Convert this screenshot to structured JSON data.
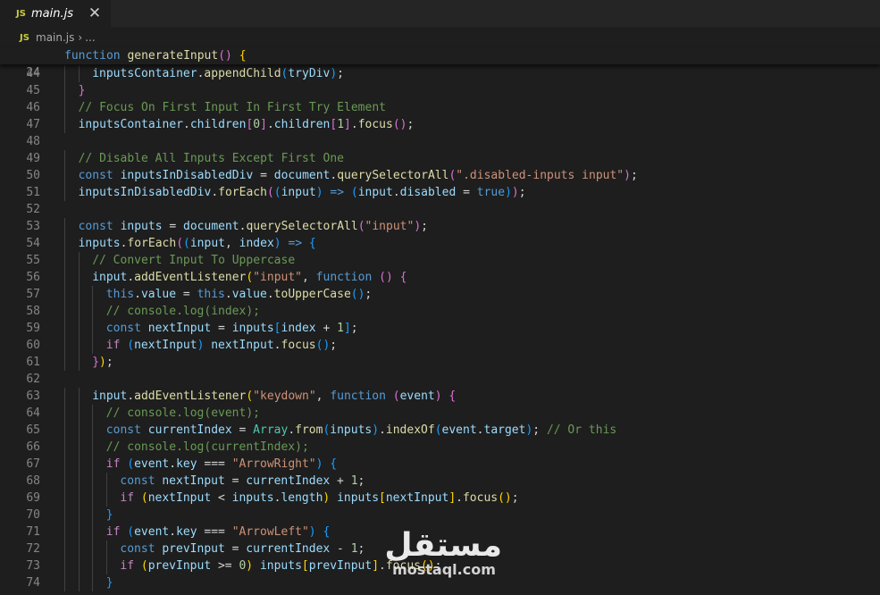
{
  "tab": {
    "icon": "JS",
    "label": "main.js",
    "close": "✕"
  },
  "breadcrumb": {
    "icon": "JS",
    "file": "main.js",
    "separator": "›",
    "ellipsis": "..."
  },
  "sticky": {
    "number": "24",
    "tokens": [
      [
        "t-kw",
        "function"
      ],
      [
        "t-plain",
        " "
      ],
      [
        "t-fn",
        "generateInput"
      ],
      [
        "t-b2",
        "()"
      ],
      [
        "t-plain",
        " "
      ],
      [
        "t-b1",
        "{"
      ]
    ]
  },
  "lines": [
    {
      "n": "44",
      "i": 2,
      "t": [
        [
          "t-var",
          "inputsContainer"
        ],
        [
          "t-plain",
          "."
        ],
        [
          "t-fn",
          "appendChild"
        ],
        [
          "t-b3",
          "("
        ],
        [
          "t-var",
          "tryDiv"
        ],
        [
          "t-b3",
          ")"
        ],
        [
          "t-plain",
          ";"
        ]
      ]
    },
    {
      "n": "45",
      "i": 1,
      "t": [
        [
          "t-b2",
          "}"
        ]
      ]
    },
    {
      "n": "46",
      "i": 1,
      "t": [
        [
          "t-com",
          "// Focus On First Input In First Try Element"
        ]
      ]
    },
    {
      "n": "47",
      "i": 1,
      "t": [
        [
          "t-var",
          "inputsContainer"
        ],
        [
          "t-plain",
          "."
        ],
        [
          "t-var",
          "children"
        ],
        [
          "t-b2",
          "["
        ],
        [
          "t-num",
          "0"
        ],
        [
          "t-b2",
          "]"
        ],
        [
          "t-plain",
          "."
        ],
        [
          "t-var",
          "children"
        ],
        [
          "t-b2",
          "["
        ],
        [
          "t-num",
          "1"
        ],
        [
          "t-b2",
          "]"
        ],
        [
          "t-plain",
          "."
        ],
        [
          "t-fn",
          "focus"
        ],
        [
          "t-b2",
          "()"
        ],
        [
          "t-plain",
          ";"
        ]
      ]
    },
    {
      "n": "48",
      "i": 0,
      "t": []
    },
    {
      "n": "49",
      "i": 1,
      "t": [
        [
          "t-com",
          "// Disable All Inputs Except First One"
        ]
      ]
    },
    {
      "n": "50",
      "i": 1,
      "t": [
        [
          "t-kw",
          "const"
        ],
        [
          "t-plain",
          " "
        ],
        [
          "t-var",
          "inputsInDisabledDiv"
        ],
        [
          "t-plain",
          " = "
        ],
        [
          "t-var",
          "document"
        ],
        [
          "t-plain",
          "."
        ],
        [
          "t-fn",
          "querySelectorAll"
        ],
        [
          "t-b2",
          "("
        ],
        [
          "t-str",
          "\".disabled-inputs input\""
        ],
        [
          "t-b2",
          ")"
        ],
        [
          "t-plain",
          ";"
        ]
      ]
    },
    {
      "n": "51",
      "i": 1,
      "t": [
        [
          "t-var",
          "inputsInDisabledDiv"
        ],
        [
          "t-plain",
          "."
        ],
        [
          "t-fn",
          "forEach"
        ],
        [
          "t-b2",
          "("
        ],
        [
          "t-b3",
          "("
        ],
        [
          "t-var",
          "input"
        ],
        [
          "t-b3",
          ")"
        ],
        [
          "t-plain",
          " "
        ],
        [
          "t-kw",
          "=>"
        ],
        [
          "t-plain",
          " "
        ],
        [
          "t-b3",
          "("
        ],
        [
          "t-var",
          "input"
        ],
        [
          "t-plain",
          "."
        ],
        [
          "t-var",
          "disabled"
        ],
        [
          "t-plain",
          " = "
        ],
        [
          "t-kw",
          "true"
        ],
        [
          "t-b3",
          ")"
        ],
        [
          "t-b2",
          ")"
        ],
        [
          "t-plain",
          ";"
        ]
      ]
    },
    {
      "n": "52",
      "i": 0,
      "t": []
    },
    {
      "n": "53",
      "i": 1,
      "t": [
        [
          "t-kw",
          "const"
        ],
        [
          "t-plain",
          " "
        ],
        [
          "t-var",
          "inputs"
        ],
        [
          "t-plain",
          " = "
        ],
        [
          "t-var",
          "document"
        ],
        [
          "t-plain",
          "."
        ],
        [
          "t-fn",
          "querySelectorAll"
        ],
        [
          "t-b2",
          "("
        ],
        [
          "t-str",
          "\"input\""
        ],
        [
          "t-b2",
          ")"
        ],
        [
          "t-plain",
          ";"
        ]
      ]
    },
    {
      "n": "54",
      "i": 1,
      "t": [
        [
          "t-var",
          "inputs"
        ],
        [
          "t-plain",
          "."
        ],
        [
          "t-fn",
          "forEach"
        ],
        [
          "t-b2",
          "("
        ],
        [
          "t-b3",
          "("
        ],
        [
          "t-var",
          "input"
        ],
        [
          "t-plain",
          ", "
        ],
        [
          "t-var",
          "index"
        ],
        [
          "t-b3",
          ")"
        ],
        [
          "t-plain",
          " "
        ],
        [
          "t-kw",
          "=>"
        ],
        [
          "t-plain",
          " "
        ],
        [
          "t-b3",
          "{"
        ]
      ]
    },
    {
      "n": "55",
      "i": 2,
      "t": [
        [
          "t-com",
          "// Convert Input To Uppercase"
        ]
      ]
    },
    {
      "n": "56",
      "i": 2,
      "t": [
        [
          "t-var",
          "input"
        ],
        [
          "t-plain",
          "."
        ],
        [
          "t-fn",
          "addEventListener"
        ],
        [
          "t-b1",
          "("
        ],
        [
          "t-str",
          "\"input\""
        ],
        [
          "t-plain",
          ", "
        ],
        [
          "t-kw",
          "function"
        ],
        [
          "t-plain",
          " "
        ],
        [
          "t-b2",
          "()"
        ],
        [
          "t-plain",
          " "
        ],
        [
          "t-b2",
          "{"
        ]
      ]
    },
    {
      "n": "57",
      "i": 3,
      "t": [
        [
          "t-kw",
          "this"
        ],
        [
          "t-plain",
          "."
        ],
        [
          "t-var",
          "value"
        ],
        [
          "t-plain",
          " = "
        ],
        [
          "t-kw",
          "this"
        ],
        [
          "t-plain",
          "."
        ],
        [
          "t-var",
          "value"
        ],
        [
          "t-plain",
          "."
        ],
        [
          "t-fn",
          "toUpperCase"
        ],
        [
          "t-b3",
          "()"
        ],
        [
          "t-plain",
          ";"
        ]
      ]
    },
    {
      "n": "58",
      "i": 3,
      "t": [
        [
          "t-com",
          "// console.log(index);"
        ]
      ]
    },
    {
      "n": "59",
      "i": 3,
      "t": [
        [
          "t-kw",
          "const"
        ],
        [
          "t-plain",
          " "
        ],
        [
          "t-var",
          "nextInput"
        ],
        [
          "t-plain",
          " = "
        ],
        [
          "t-var",
          "inputs"
        ],
        [
          "t-b3",
          "["
        ],
        [
          "t-var",
          "index"
        ],
        [
          "t-plain",
          " + "
        ],
        [
          "t-num",
          "1"
        ],
        [
          "t-b3",
          "]"
        ],
        [
          "t-plain",
          ";"
        ]
      ]
    },
    {
      "n": "60",
      "i": 3,
      "t": [
        [
          "t-ctrl",
          "if"
        ],
        [
          "t-plain",
          " "
        ],
        [
          "t-b3",
          "("
        ],
        [
          "t-var",
          "nextInput"
        ],
        [
          "t-b3",
          ")"
        ],
        [
          "t-plain",
          " "
        ],
        [
          "t-var",
          "nextInput"
        ],
        [
          "t-plain",
          "."
        ],
        [
          "t-fn",
          "focus"
        ],
        [
          "t-b3",
          "()"
        ],
        [
          "t-plain",
          ";"
        ]
      ]
    },
    {
      "n": "61",
      "i": 2,
      "t": [
        [
          "t-b2",
          "}"
        ],
        [
          "t-b1",
          ")"
        ],
        [
          "t-plain",
          ";"
        ]
      ]
    },
    {
      "n": "62",
      "i": 0,
      "t": []
    },
    {
      "n": "63",
      "i": 2,
      "t": [
        [
          "t-var",
          "input"
        ],
        [
          "t-plain",
          "."
        ],
        [
          "t-fn",
          "addEventListener"
        ],
        [
          "t-b1",
          "("
        ],
        [
          "t-str",
          "\"keydown\""
        ],
        [
          "t-plain",
          ", "
        ],
        [
          "t-kw",
          "function"
        ],
        [
          "t-plain",
          " "
        ],
        [
          "t-b2",
          "("
        ],
        [
          "t-var",
          "event"
        ],
        [
          "t-b2",
          ")"
        ],
        [
          "t-plain",
          " "
        ],
        [
          "t-b2",
          "{"
        ]
      ]
    },
    {
      "n": "64",
      "i": 3,
      "t": [
        [
          "t-com",
          "// console.log(event);"
        ]
      ]
    },
    {
      "n": "65",
      "i": 3,
      "t": [
        [
          "t-kw",
          "const"
        ],
        [
          "t-plain",
          " "
        ],
        [
          "t-var",
          "currentIndex"
        ],
        [
          "t-plain",
          " = "
        ],
        [
          "t-cls",
          "Array"
        ],
        [
          "t-plain",
          "."
        ],
        [
          "t-fn",
          "from"
        ],
        [
          "t-b3",
          "("
        ],
        [
          "t-var",
          "inputs"
        ],
        [
          "t-b3",
          ")"
        ],
        [
          "t-plain",
          "."
        ],
        [
          "t-fn",
          "indexOf"
        ],
        [
          "t-b3",
          "("
        ],
        [
          "t-var",
          "event"
        ],
        [
          "t-plain",
          "."
        ],
        [
          "t-var",
          "target"
        ],
        [
          "t-b3",
          ")"
        ],
        [
          "t-plain",
          "; "
        ],
        [
          "t-com",
          "// Or this"
        ]
      ]
    },
    {
      "n": "66",
      "i": 3,
      "t": [
        [
          "t-com",
          "// console.log(currentIndex);"
        ]
      ]
    },
    {
      "n": "67",
      "i": 3,
      "t": [
        [
          "t-ctrl",
          "if"
        ],
        [
          "t-plain",
          " "
        ],
        [
          "t-b3",
          "("
        ],
        [
          "t-var",
          "event"
        ],
        [
          "t-plain",
          "."
        ],
        [
          "t-var",
          "key"
        ],
        [
          "t-plain",
          " === "
        ],
        [
          "t-str",
          "\"ArrowRight\""
        ],
        [
          "t-b3",
          ")"
        ],
        [
          "t-plain",
          " "
        ],
        [
          "t-b3",
          "{"
        ]
      ]
    },
    {
      "n": "68",
      "i": 4,
      "t": [
        [
          "t-kw",
          "const"
        ],
        [
          "t-plain",
          " "
        ],
        [
          "t-var",
          "nextInput"
        ],
        [
          "t-plain",
          " = "
        ],
        [
          "t-var",
          "currentIndex"
        ],
        [
          "t-plain",
          " + "
        ],
        [
          "t-num",
          "1"
        ],
        [
          "t-plain",
          ";"
        ]
      ]
    },
    {
      "n": "69",
      "i": 4,
      "t": [
        [
          "t-ctrl",
          "if"
        ],
        [
          "t-plain",
          " "
        ],
        [
          "t-b1",
          "("
        ],
        [
          "t-var",
          "nextInput"
        ],
        [
          "t-plain",
          " < "
        ],
        [
          "t-var",
          "inputs"
        ],
        [
          "t-plain",
          "."
        ],
        [
          "t-var",
          "length"
        ],
        [
          "t-b1",
          ")"
        ],
        [
          "t-plain",
          " "
        ],
        [
          "t-var",
          "inputs"
        ],
        [
          "t-b1",
          "["
        ],
        [
          "t-var",
          "nextInput"
        ],
        [
          "t-b1",
          "]"
        ],
        [
          "t-plain",
          "."
        ],
        [
          "t-fn",
          "focus"
        ],
        [
          "t-b1",
          "()"
        ],
        [
          "t-plain",
          ";"
        ]
      ]
    },
    {
      "n": "70",
      "i": 3,
      "t": [
        [
          "t-b3",
          "}"
        ]
      ]
    },
    {
      "n": "71",
      "i": 3,
      "t": [
        [
          "t-ctrl",
          "if"
        ],
        [
          "t-plain",
          " "
        ],
        [
          "t-b3",
          "("
        ],
        [
          "t-var",
          "event"
        ],
        [
          "t-plain",
          "."
        ],
        [
          "t-var",
          "key"
        ],
        [
          "t-plain",
          " === "
        ],
        [
          "t-str",
          "\"ArrowLeft\""
        ],
        [
          "t-b3",
          ")"
        ],
        [
          "t-plain",
          " "
        ],
        [
          "t-b3",
          "{"
        ]
      ]
    },
    {
      "n": "72",
      "i": 4,
      "t": [
        [
          "t-kw",
          "const"
        ],
        [
          "t-plain",
          " "
        ],
        [
          "t-var",
          "prevInput"
        ],
        [
          "t-plain",
          " = "
        ],
        [
          "t-var",
          "currentIndex"
        ],
        [
          "t-plain",
          " - "
        ],
        [
          "t-num",
          "1"
        ],
        [
          "t-plain",
          ";"
        ]
      ]
    },
    {
      "n": "73",
      "i": 4,
      "t": [
        [
          "t-ctrl",
          "if"
        ],
        [
          "t-plain",
          " "
        ],
        [
          "t-b1",
          "("
        ],
        [
          "t-var",
          "prevInput"
        ],
        [
          "t-plain",
          " >= "
        ],
        [
          "t-num",
          "0"
        ],
        [
          "t-b1",
          ")"
        ],
        [
          "t-plain",
          " "
        ],
        [
          "t-var",
          "inputs"
        ],
        [
          "t-b1",
          "["
        ],
        [
          "t-var",
          "prevInput"
        ],
        [
          "t-b1",
          "]"
        ],
        [
          "t-plain",
          "."
        ],
        [
          "t-fn",
          "focus"
        ],
        [
          "t-b1",
          "()"
        ],
        [
          "t-plain",
          ";"
        ]
      ]
    },
    {
      "n": "74",
      "i": 3,
      "t": [
        [
          "t-b3",
          "}"
        ]
      ]
    }
  ],
  "watermark": {
    "arabic": "مستقل",
    "latin": "mostaql.com"
  }
}
